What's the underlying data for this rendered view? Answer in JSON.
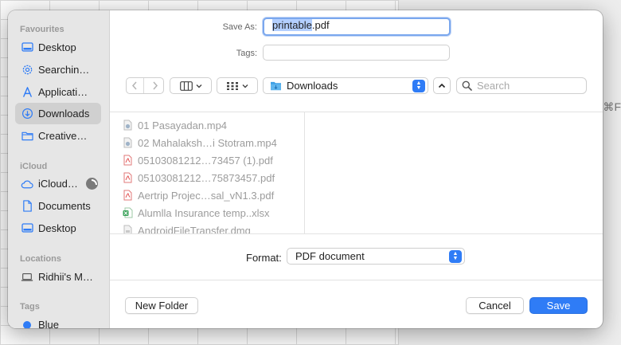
{
  "background": {
    "shortcut_fragment": "⌘F"
  },
  "sidebar": {
    "favourites_header": "Favourites",
    "favourites": [
      {
        "label": "Desktop",
        "icon": "desktop-icon"
      },
      {
        "label": "Searchin…",
        "icon": "gear-icon"
      },
      {
        "label": "Applicati…",
        "icon": "applications-icon"
      },
      {
        "label": "Downloads",
        "icon": "download-icon",
        "selected": true
      },
      {
        "label": "Creative…",
        "icon": "folder-icon"
      }
    ],
    "icloud_header": "iCloud",
    "icloud": [
      {
        "label": "iCloud…",
        "icon": "cloud-icon"
      },
      {
        "label": "Documents",
        "icon": "document-icon"
      },
      {
        "label": "Desktop",
        "icon": "desktop-icon"
      }
    ],
    "locations_header": "Locations",
    "locations": [
      {
        "label": "Ridhii's M…",
        "icon": "laptop-icon"
      }
    ],
    "tags_header": "Tags",
    "tags": [
      {
        "label": "Blue",
        "color": "#2f7cf6"
      }
    ]
  },
  "save_as": {
    "label": "Save As:",
    "selected_part": "printable",
    "rest": ".pdf"
  },
  "tags": {
    "label": "Tags:",
    "value": ""
  },
  "toolbar": {
    "location": "Downloads",
    "search_placeholder": "Search"
  },
  "files": [
    {
      "name": "01 Pasayadan.mp4",
      "type": "video"
    },
    {
      "name": "02 Mahalaksh…i Stotram.mp4",
      "type": "video"
    },
    {
      "name": "05103081212…73457 (1).pdf",
      "type": "pdf"
    },
    {
      "name": "05103081212…75873457.pdf",
      "type": "pdf"
    },
    {
      "name": "Aertrip Projec…sal_vN1.3.pdf",
      "type": "pdf"
    },
    {
      "name": "Alumlla Insurance temp..xlsx",
      "type": "xlsx"
    },
    {
      "name": "AndroidFileTransfer.dmg",
      "type": "dmg"
    }
  ],
  "format": {
    "label": "Format:",
    "value": "PDF document"
  },
  "buttons": {
    "new_folder": "New Folder",
    "cancel": "Cancel",
    "save": "Save"
  },
  "colors": {
    "accent": "#2f7cf6",
    "selection_highlight": "#b3cfff"
  }
}
